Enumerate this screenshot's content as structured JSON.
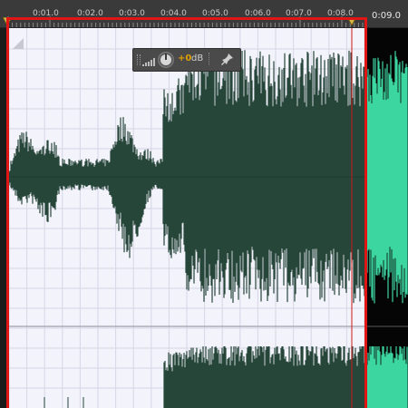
{
  "ruler": {
    "tick_labels": [
      "0:01.0",
      "0:02.0",
      "0:03.0",
      "0:04.0",
      "0:05.0",
      "0:06.0",
      "0:07.0",
      "0:08.0"
    ],
    "outside_time": "0:09.0"
  },
  "hud": {
    "gain_value": "+0",
    "gain_unit": "dB"
  },
  "colors": {
    "selection_background": "#f3f3fb",
    "waveform_selected": "#26463a",
    "waveform_unselected": "#3dd6a0",
    "outside_background": "#050505",
    "selection_border": "#e01616",
    "playhead": "#d01818",
    "hud_value": "#e0a000"
  },
  "icons": [
    "volume-bars-icon",
    "gain-knob-icon",
    "pin-icon",
    "corner-marker-icon"
  ]
}
